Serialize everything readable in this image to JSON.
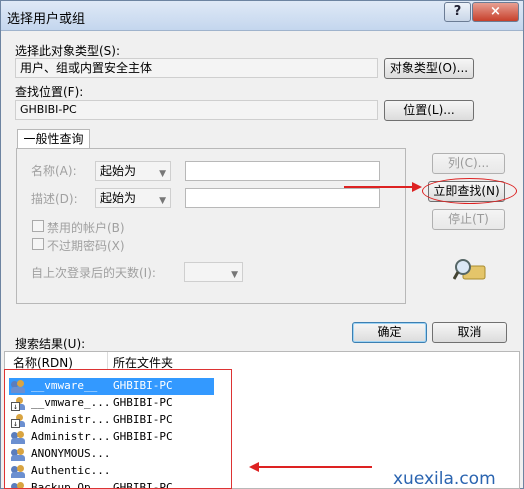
{
  "window": {
    "title": "选择用户或组",
    "help": "?",
    "close": "×"
  },
  "object_type": {
    "label": "选择此对象类型(S):",
    "value": "用户、组或内置安全主体",
    "button": "对象类型(O)..."
  },
  "location": {
    "label": "查找位置(F):",
    "value": "GHBIBI-PC",
    "button": "位置(L)..."
  },
  "query": {
    "tab": "一般性查询",
    "name_label": "名称(A):",
    "name_combo": "起始为",
    "desc_label": "描述(D):",
    "desc_combo": "起始为",
    "disabled_accounts": "禁用的帐户(B)",
    "non_expiring": "不过期密码(X)",
    "days_label": "自上次登录后的天数(I):"
  },
  "side_buttons": {
    "columns": "列(C)...",
    "find_now": "立即查找(N)",
    "stop": "停止(T)"
  },
  "actions": {
    "ok": "确定",
    "cancel": "取消"
  },
  "results": {
    "label": "搜索结果(U):",
    "columns": [
      "名称(RDN)",
      "所在文件夹"
    ],
    "rows": [
      {
        "name": "__vmware__",
        "folder": "GHBIBI-PC",
        "icon": "group-icon",
        "selected": true
      },
      {
        "name": "__vmware_...",
        "folder": "GHBIBI-PC",
        "icon": "user-down-icon",
        "selected": false
      },
      {
        "name": "Administr...",
        "folder": "GHBIBI-PC",
        "icon": "user-down-icon",
        "selected": false
      },
      {
        "name": "Administr...",
        "folder": "GHBIBI-PC",
        "icon": "group-icon",
        "selected": false
      },
      {
        "name": "ANONYMOUS...",
        "folder": "",
        "icon": "group-icon",
        "selected": false
      },
      {
        "name": "Authentic...",
        "folder": "",
        "icon": "group-icon",
        "selected": false
      },
      {
        "name": "Backup Op...",
        "folder": "GHBIBI-PC",
        "icon": "group-icon",
        "selected": false
      }
    ]
  },
  "watermark": "xuexila.com",
  "colors": {
    "selection": "#3399ff",
    "annotation": "#dd2222",
    "watermark": "#2a64b0"
  }
}
